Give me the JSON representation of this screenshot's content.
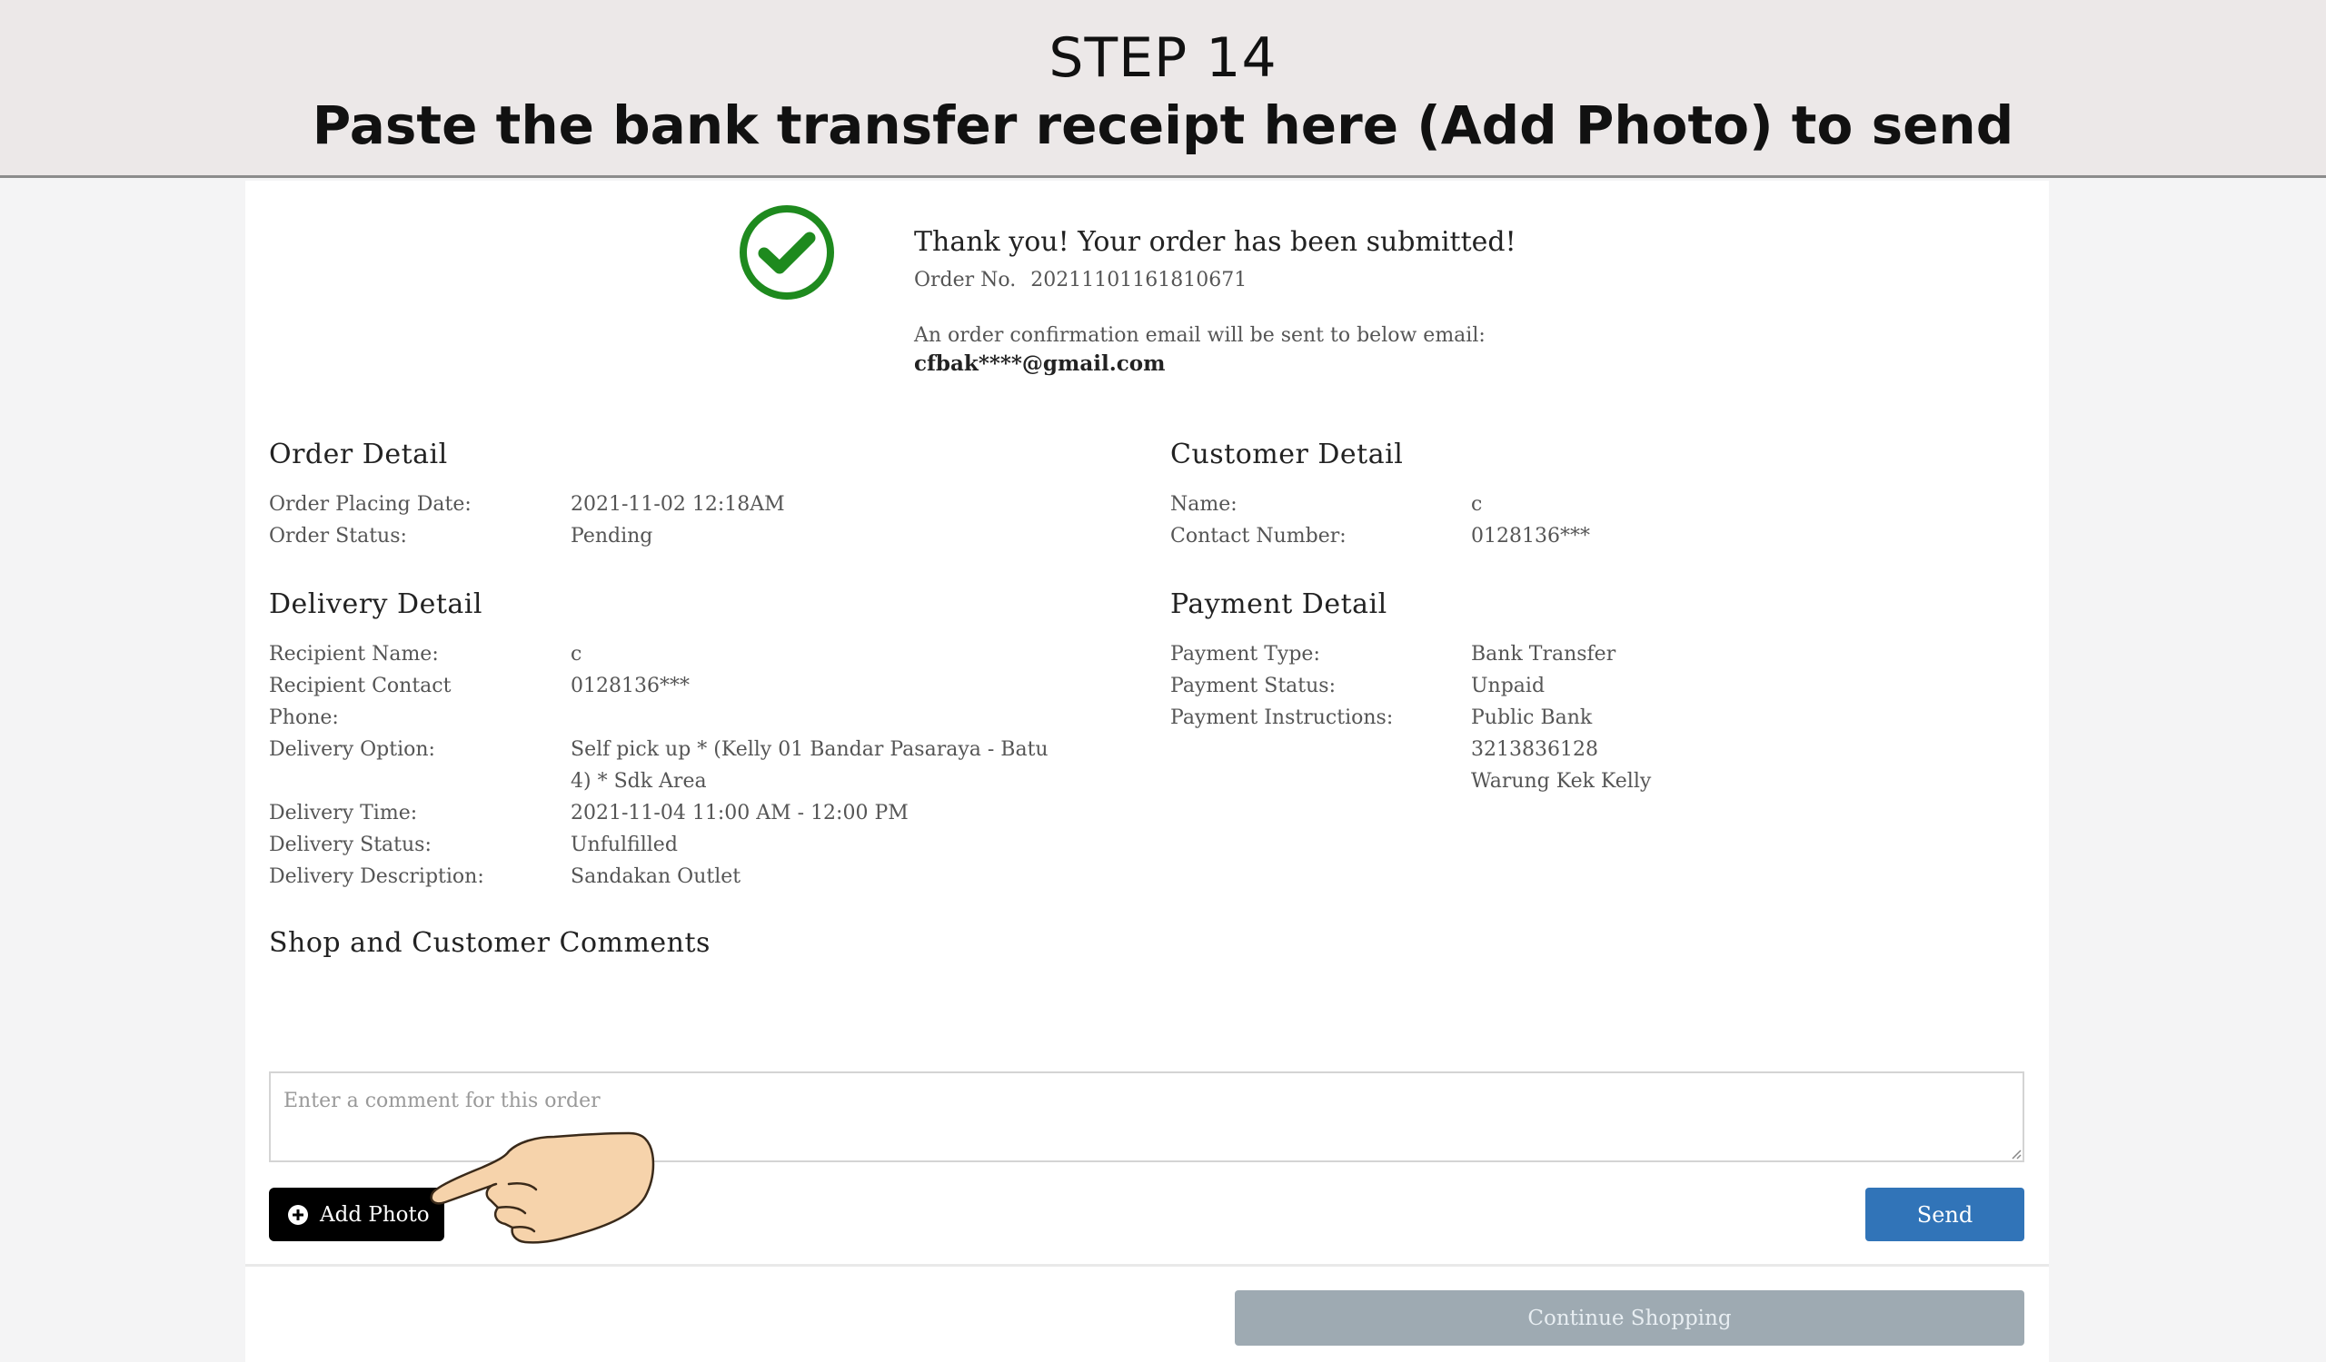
{
  "banner": {
    "step": "STEP 14",
    "instruction": "Paste the bank transfer receipt here (Add Photo) to send"
  },
  "confirmation": {
    "check_icon": "check-circle-icon",
    "title": "Thank you! Your order has been submitted!",
    "order_no_label": "Order No.",
    "order_no": "20211101161810671",
    "email_note": "An order confirmation email will be sent to below email:",
    "email": "cfbak****@gmail.com"
  },
  "order_detail": {
    "title": "Order Detail",
    "rows": [
      {
        "label": "Order Placing Date:",
        "value": "2021-11-02 12:18AM"
      },
      {
        "label": "Order Status:",
        "value": "Pending"
      }
    ]
  },
  "customer_detail": {
    "title": "Customer Detail",
    "rows": [
      {
        "label": "Name:",
        "value": "c"
      },
      {
        "label": "Contact Number:",
        "value": "0128136***"
      }
    ]
  },
  "delivery_detail": {
    "title": "Delivery Detail",
    "rows": [
      {
        "label": "Recipient Name:",
        "value": "c"
      },
      {
        "label": "Recipient Contact",
        "value": "0128136***"
      },
      {
        "label": "Phone:",
        "value": ""
      },
      {
        "label": "Delivery Option:",
        "value": "Self pick up * (Kelly 01 Bandar Pasaraya - Batu"
      },
      {
        "label": "",
        "value": "4) * Sdk Area"
      },
      {
        "label": "Delivery Time:",
        "value": "2021-11-04 11:00 AM - 12:00 PM"
      },
      {
        "label": "Delivery Status:",
        "value": "Unfulfilled"
      },
      {
        "label": "Delivery Description:",
        "value": "Sandakan Outlet"
      }
    ]
  },
  "payment_detail": {
    "title": "Payment Detail",
    "rows": [
      {
        "label": "Payment Type:",
        "value": "Bank Transfer"
      },
      {
        "label": "Payment Status:",
        "value": "Unpaid"
      },
      {
        "label": "Payment Instructions:",
        "value": "Public Bank"
      },
      {
        "label": "",
        "value": "3213836128"
      },
      {
        "label": "",
        "value": "Warung Kek Kelly"
      }
    ]
  },
  "comments": {
    "title": "Shop and Customer Comments",
    "placeholder": "Enter a comment for this order",
    "add_photo_label": "Add Photo",
    "add_photo_icon": "plus-circle-icon",
    "send_label": "Send"
  },
  "footer": {
    "continue_label": "Continue Shopping"
  },
  "colors": {
    "check_green": "#1e8a1e",
    "send_blue": "#3174b8",
    "continue_gray": "#9eaab2"
  }
}
